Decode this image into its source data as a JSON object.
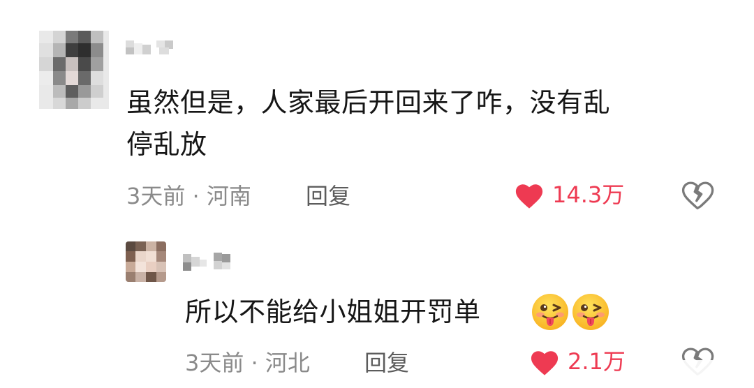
{
  "comments": [
    {
      "text_line1": "虽然但是，人家最后开回来了咋，没有乱",
      "text_line2": "停乱放",
      "meta": "3天前 · 河南",
      "reply_label": "回复",
      "likes": "14.3万",
      "like_color": "#ee3a52",
      "liked": true
    },
    {
      "text": "所以不能给小姐姐开罚单",
      "emojis": [
        "tongue-out-wink-emoji",
        "tongue-out-wink-emoji"
      ],
      "meta": "3天前 · 河北",
      "reply_label": "回复",
      "likes": "2.1万",
      "like_color": "#ee3a52",
      "liked": true
    }
  ]
}
